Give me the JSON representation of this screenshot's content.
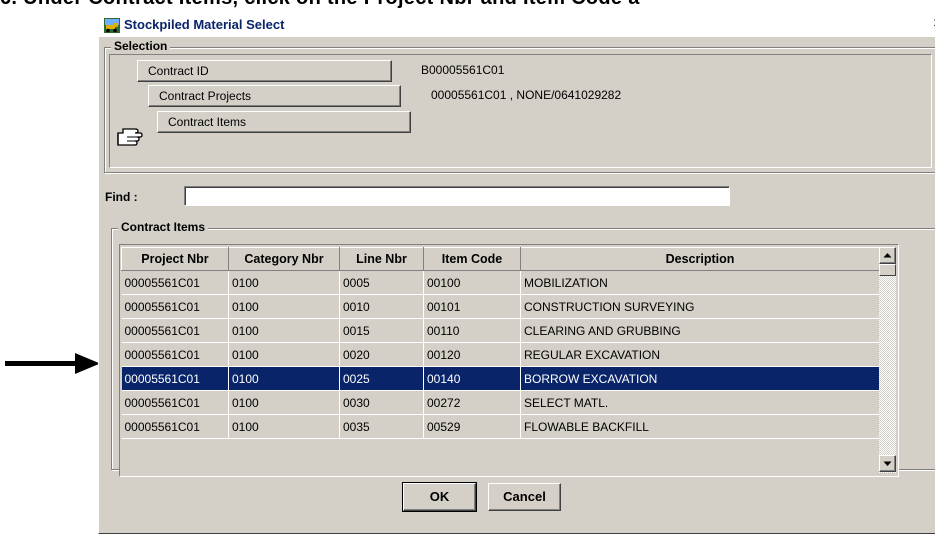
{
  "background_text": "6.   Under Contract Items, click on the Project Nbr and Item Code a",
  "window": {
    "title": "Stockpiled Material Select",
    "close_glyph": "×"
  },
  "selection": {
    "group_label": "Selection",
    "buttons": [
      {
        "label": "Contract ID",
        "value": "B00005561C01"
      },
      {
        "label": "Contract Projects",
        "value": "00005561C01  , NONE/0641029282"
      },
      {
        "label": "Contract Items",
        "value": ""
      }
    ]
  },
  "find": {
    "label": "Find :",
    "value": ""
  },
  "contract_items": {
    "group_label": "Contract Items",
    "columns": [
      "Project Nbr",
      "Category Nbr",
      "Line Nbr",
      "Item Code",
      "Description"
    ],
    "rows": [
      [
        "00005561C01",
        "0100",
        "0005",
        "00100",
        "MOBILIZATION"
      ],
      [
        "00005561C01",
        "0100",
        "0010",
        "00101",
        "CONSTRUCTION SURVEYING"
      ],
      [
        "00005561C01",
        "0100",
        "0015",
        "00110",
        "CLEARING AND GRUBBING"
      ],
      [
        "00005561C01",
        "0100",
        "0020",
        "00120",
        "REGULAR EXCAVATION"
      ],
      [
        "00005561C01",
        "0100",
        "0025",
        "00140",
        "BORROW EXCAVATION"
      ],
      [
        "00005561C01",
        "0100",
        "0030",
        "00272",
        "SELECT MATL."
      ],
      [
        "00005561C01",
        "0100",
        "0035",
        "00529",
        "FLOWABLE BACKFILL"
      ]
    ],
    "selected_row_index": 4
  },
  "actions": {
    "ok_label": "OK",
    "cancel_label": "Cancel"
  },
  "icons": {
    "app": "stockpile-app-icon",
    "pointer": "pointing-hand-icon",
    "arrow": "right-arrow-icon",
    "scroll_up": "scroll-up-arrow-icon",
    "scroll_down": "scroll-down-arrow-icon"
  },
  "colors": {
    "selection_bg": "#0a246a",
    "title_text": "#0a246a",
    "dialog_bg": "#d4d0c8"
  }
}
